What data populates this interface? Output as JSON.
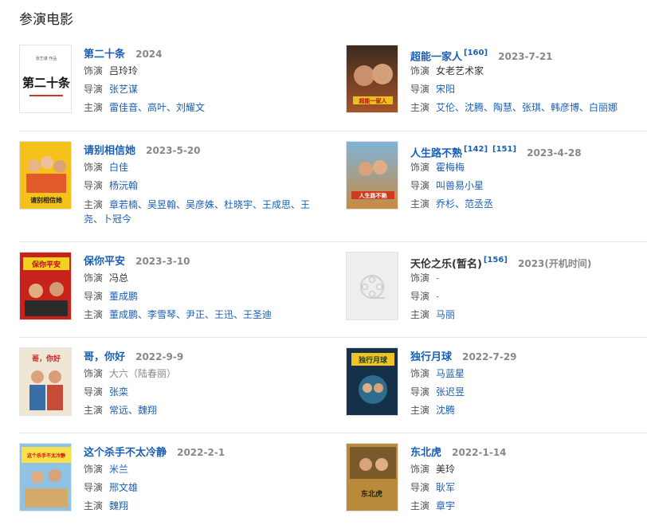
{
  "section_title": "参演电影",
  "labels": {
    "role": "饰演",
    "director": "导演",
    "starring": "主演"
  },
  "films": [
    {
      "title": "第二十条",
      "refs": [],
      "year": "2024",
      "role": "吕玲玲",
      "role_link": true,
      "director": "张艺谋",
      "starring": "雷佳音、高叶、刘耀文",
      "poster_text": "第二十条"
    },
    {
      "title": "超能一家人",
      "refs": [
        "[160]"
      ],
      "year": "2023-7-21",
      "role": "女老艺术家",
      "role_link": false,
      "director": "宋阳",
      "starring": "艾伦、沈腾、陶慧、张琪、韩彦博、白丽娜",
      "poster_text": "超能一家人"
    },
    {
      "title": "请别相信她",
      "refs": [],
      "year": "2023-5-20",
      "role": "白佳",
      "role_link": true,
      "director": "杨沅翰",
      "starring": "章若楠、吴昱翰、吴彦姝、杜晓宇、王成思、王尧、卜冠今",
      "poster_text": "请别相信她"
    },
    {
      "title": "人生路不熟",
      "refs": [
        "[142]",
        "[151]"
      ],
      "year": "2023-4-28",
      "role": "霍梅梅",
      "role_link": true,
      "director": "叫兽易小星",
      "starring": "乔杉、范丞丞",
      "poster_text": "人生路不熟"
    },
    {
      "title": "保你平安",
      "refs": [],
      "year": "2023-3-10",
      "role": "冯总",
      "role_link": false,
      "director": "董成鹏",
      "starring": "董成鹏、李雪琴、尹正、王迅、王圣迪",
      "poster_text": "保你平安"
    },
    {
      "title": "天伦之乐(暂名)",
      "refs": [
        "[156]"
      ],
      "year": "2023(开机时间)",
      "role": "-",
      "role_link": false,
      "director": "-",
      "starring": "马丽",
      "poster_text": ""
    },
    {
      "title": "哥，你好",
      "refs": [],
      "year": "2022-9-9",
      "role": "大六（陆春丽）",
      "role_link": false,
      "director": "张栾",
      "starring": "常远、魏翔",
      "poster_text": "哥，你好"
    },
    {
      "title": "独行月球",
      "refs": [],
      "year": "2022-7-29",
      "role": "马蓝星",
      "role_link": true,
      "director": "张迟昱",
      "starring": "沈腾",
      "poster_text": "独行月球"
    },
    {
      "title": "这个杀手不太冷静",
      "refs": [],
      "year": "2022-2-1",
      "role": "米兰",
      "role_link": true,
      "director": "邢文雄",
      "starring": "魏翔",
      "poster_text": "这个杀手不太冷静"
    },
    {
      "title": "东北虎",
      "refs": [],
      "year": "2022-1-14",
      "role": "美玲",
      "role_link": false,
      "director": "耿军",
      "starring": "章宇",
      "poster_text": "东北虎"
    }
  ],
  "colors": {
    "link": "#1a5fb4",
    "text": "#333333",
    "muted": "#888888",
    "divider": "#e6e6e6"
  }
}
